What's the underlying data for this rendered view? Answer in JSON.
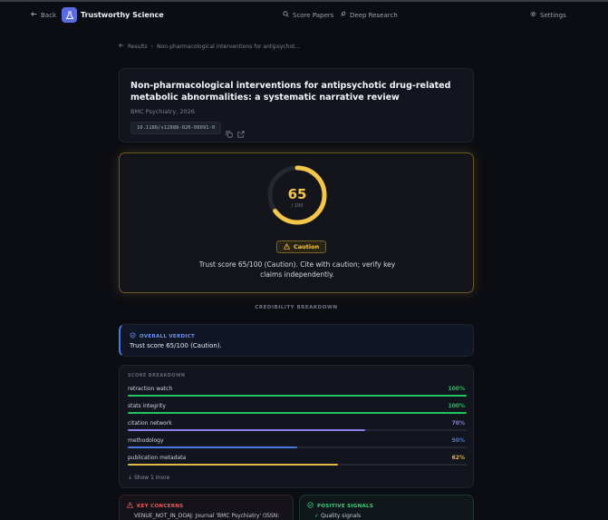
{
  "topbar": {
    "back_label": "Back",
    "brand": "Trustworthy Science",
    "nav": {
      "score_papers": "Score Papers",
      "deep_research": "Deep Research",
      "settings": "Settings"
    }
  },
  "breadcrumb": {
    "results": "Results",
    "current": "Non-pharmacological interventions for antipsychot..."
  },
  "paper": {
    "title": "Non-pharmacological interventions for antipsychotic drug-related metabolic abnormalities: a systematic narrative review",
    "venue": "BMC Psychiatry, 2026",
    "doi": "10.1186/s12888-026-08091-0"
  },
  "score": {
    "value": "65",
    "denominator": "/ 100",
    "fraction": 0.65,
    "badge": "Caution",
    "summary": "Trust score 65/100 (Caution). Cite with caution; verify key claims independently.",
    "color": "#f4c74a"
  },
  "section_label": "CREDIBILITY BREAKDOWN",
  "verdict": {
    "heading": "OVERALL VERDICT",
    "text": "Trust score 65/100 (Caution)."
  },
  "breakdown": {
    "heading": "SCORE BREAKDOWN",
    "rows": [
      {
        "label": "retraction watch",
        "value": "100%",
        "fraction": 1.0,
        "color": "#22c55e"
      },
      {
        "label": "stats integrity",
        "value": "100%",
        "fraction": 1.0,
        "color": "#22c55e"
      },
      {
        "label": "citation network",
        "value": "70%",
        "fraction": 0.7,
        "color": "#8b7cf0"
      },
      {
        "label": "methodology",
        "value": "50%",
        "fraction": 0.5,
        "color": "#4a78e0"
      },
      {
        "label": "publication metadata",
        "value": "62%",
        "fraction": 0.62,
        "color": "#e6b64a"
      }
    ],
    "show_more": "Show 1 more"
  },
  "concerns": {
    "heading": "KEY CONCERNS",
    "item": "VENUE_NOT_IN_DOAJ: Journal 'BMC Psychiatry' (ISSN:"
  },
  "signals": {
    "heading": "POSITIVE SIGNALS",
    "item": "Quality signals"
  }
}
